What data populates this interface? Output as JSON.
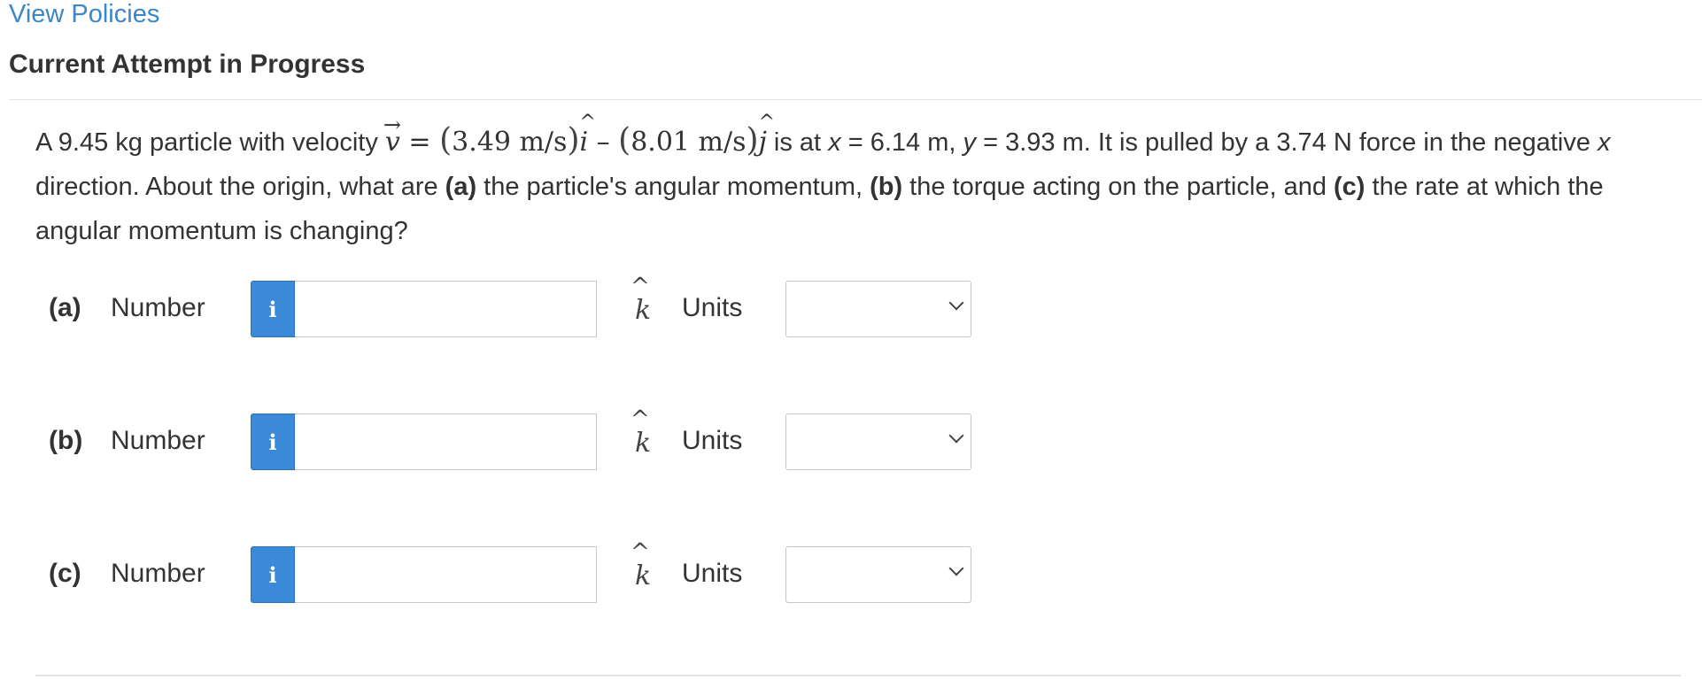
{
  "header": {
    "view_policies": "View Policies",
    "attempt_title": "Current Attempt in Progress"
  },
  "question": {
    "t1": "A 9.45 kg particle with velocity ",
    "v_symbol": "v",
    "eq": " = ",
    "vx": "3.49 m/s",
    "i_hat": "i",
    "minus": " – ",
    "vy": "8.01 m/s",
    "j_hat": "j",
    "t2": " is at ",
    "x_var": "x",
    "t3": " = 6.14 m, ",
    "y_var": "y",
    "t4": " = 3.93 m. It is pulled by a 3.74 N force in the negative ",
    "x_var2": "x",
    "t5": " direction. About the origin, what are ",
    "a_mark": "(a)",
    "t6": " the particle's angular momentum, ",
    "b_mark": "(b)",
    "t7": " the torque acting on the particle, and ",
    "c_mark": "(c)",
    "t8": " the rate at which the angular momentum is changing?"
  },
  "parts": [
    {
      "label": "(a)",
      "number_label": "Number",
      "info": "i",
      "value": "",
      "unit_vector": "k",
      "units_label": "Units",
      "units_selected": ""
    },
    {
      "label": "(b)",
      "number_label": "Number",
      "info": "i",
      "value": "",
      "unit_vector": "k",
      "units_label": "Units",
      "units_selected": ""
    },
    {
      "label": "(c)",
      "number_label": "Number",
      "info": "i",
      "value": "",
      "unit_vector": "k",
      "units_label": "Units",
      "units_selected": ""
    }
  ],
  "colors": {
    "link": "#3b87c8",
    "info_button": "#3a8ad8",
    "text": "#333333",
    "border": "#c7c7c7"
  }
}
